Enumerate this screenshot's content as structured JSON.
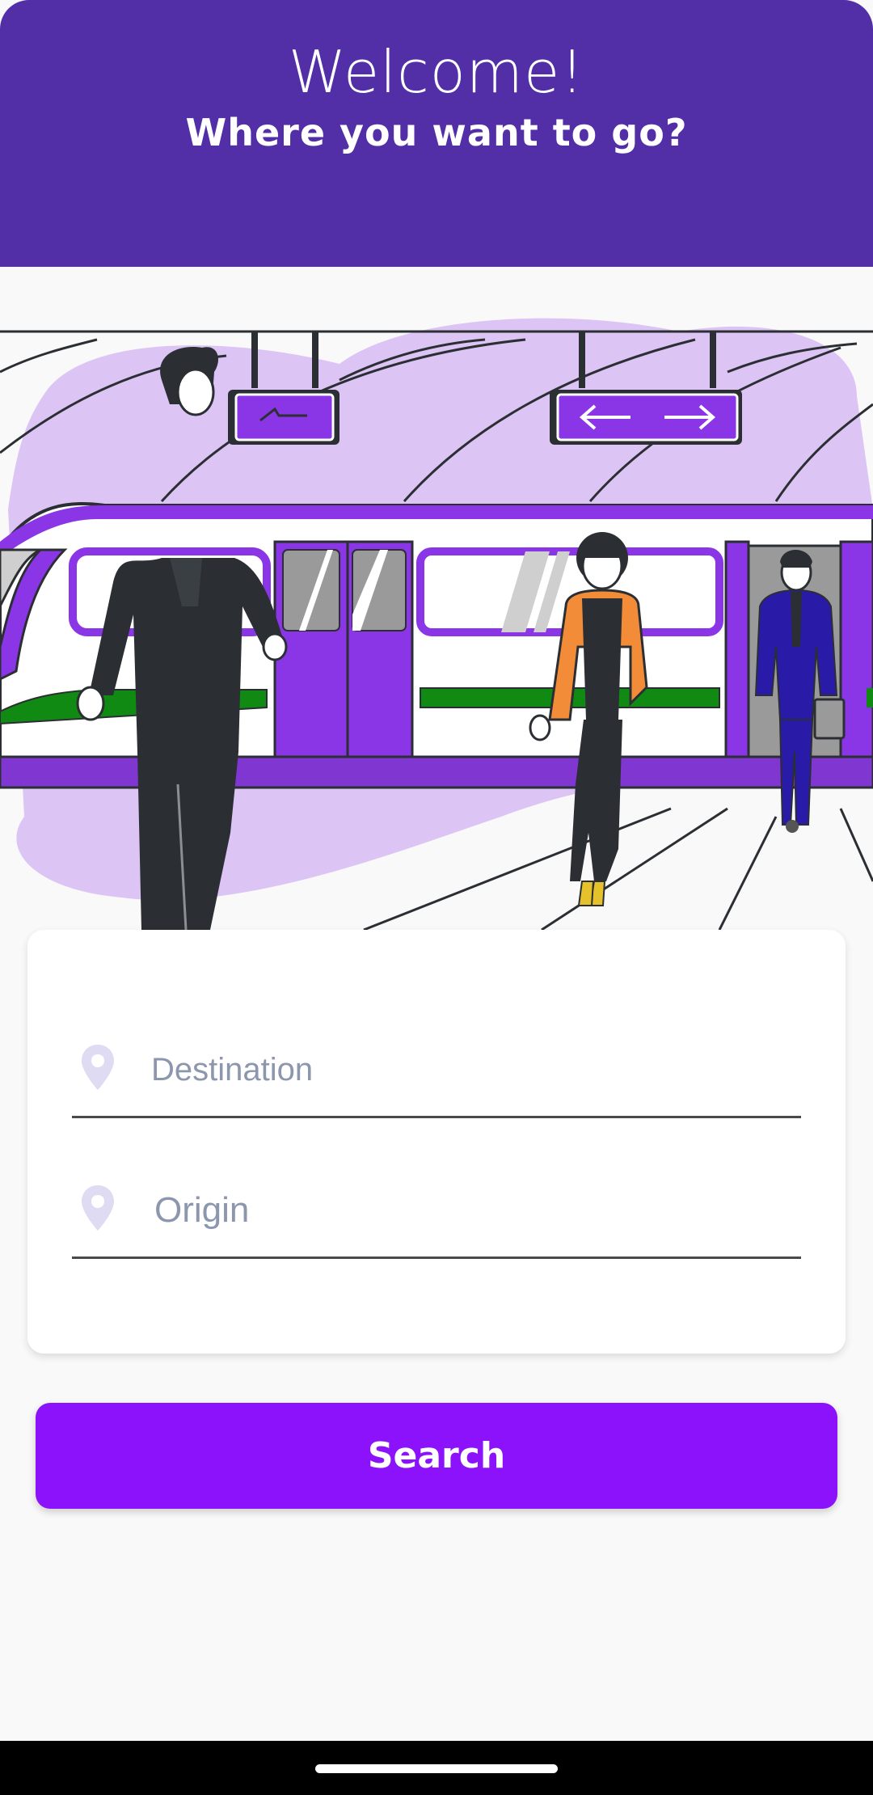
{
  "header": {
    "title": "Welcome!",
    "subtitle": "Where you want to go?"
  },
  "form": {
    "destination": {
      "placeholder": "Destination",
      "value": "",
      "icon": "location-pin-icon"
    },
    "origin": {
      "placeholder": "Origin",
      "value": "",
      "icon": "location-pin-icon"
    }
  },
  "search_button": {
    "label": "Search"
  },
  "colors": {
    "header_bg": "#522ea7",
    "accent": "#8b12fa",
    "train_purple": "#8a36e6",
    "blob": "#dcc4f5"
  }
}
